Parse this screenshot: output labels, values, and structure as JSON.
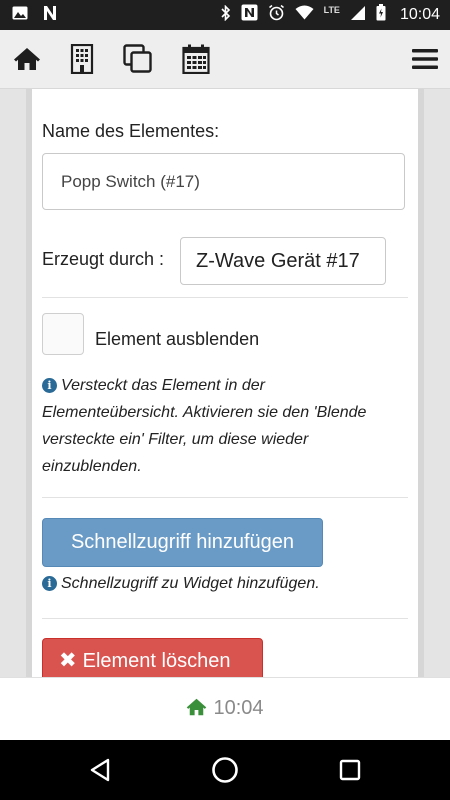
{
  "status_bar": {
    "time": "10:04",
    "network": "LTE",
    "icons": [
      "image-icon",
      "n-icon",
      "bluetooth-icon",
      "nfc-icon",
      "alarm-icon",
      "wifi-icon",
      "signal-icon",
      "battery-icon"
    ]
  },
  "top_nav": {
    "icons": [
      "home-icon",
      "building-icon",
      "copy-icon",
      "calendar-icon",
      "menu-icon"
    ]
  },
  "form": {
    "name_label": "Name des Elementes:",
    "name_value": "Popp Switch (#17)",
    "created_by_label": "Erzeugt durch :",
    "created_by_value": "Z-Wave Gerät #17",
    "hide_label": "Element ausblenden",
    "hide_help": "Versteckt das Element in der Elementeübersicht. Aktivieren sie den 'Blende versteckte ein' Filter, um diese wieder einzublenden.",
    "quick_access_button": "Schnellzugriff hinzufügen",
    "quick_access_help": "Schnellzugriff zu Widget hinzufügen.",
    "delete_button": "Element löschen"
  },
  "footer": {
    "time": "10:04"
  },
  "colors": {
    "primary_button": "#6a9bc6",
    "danger_button": "#d9534f",
    "info_icon": "#2a6a96",
    "home_green": "#3a8f3a"
  }
}
